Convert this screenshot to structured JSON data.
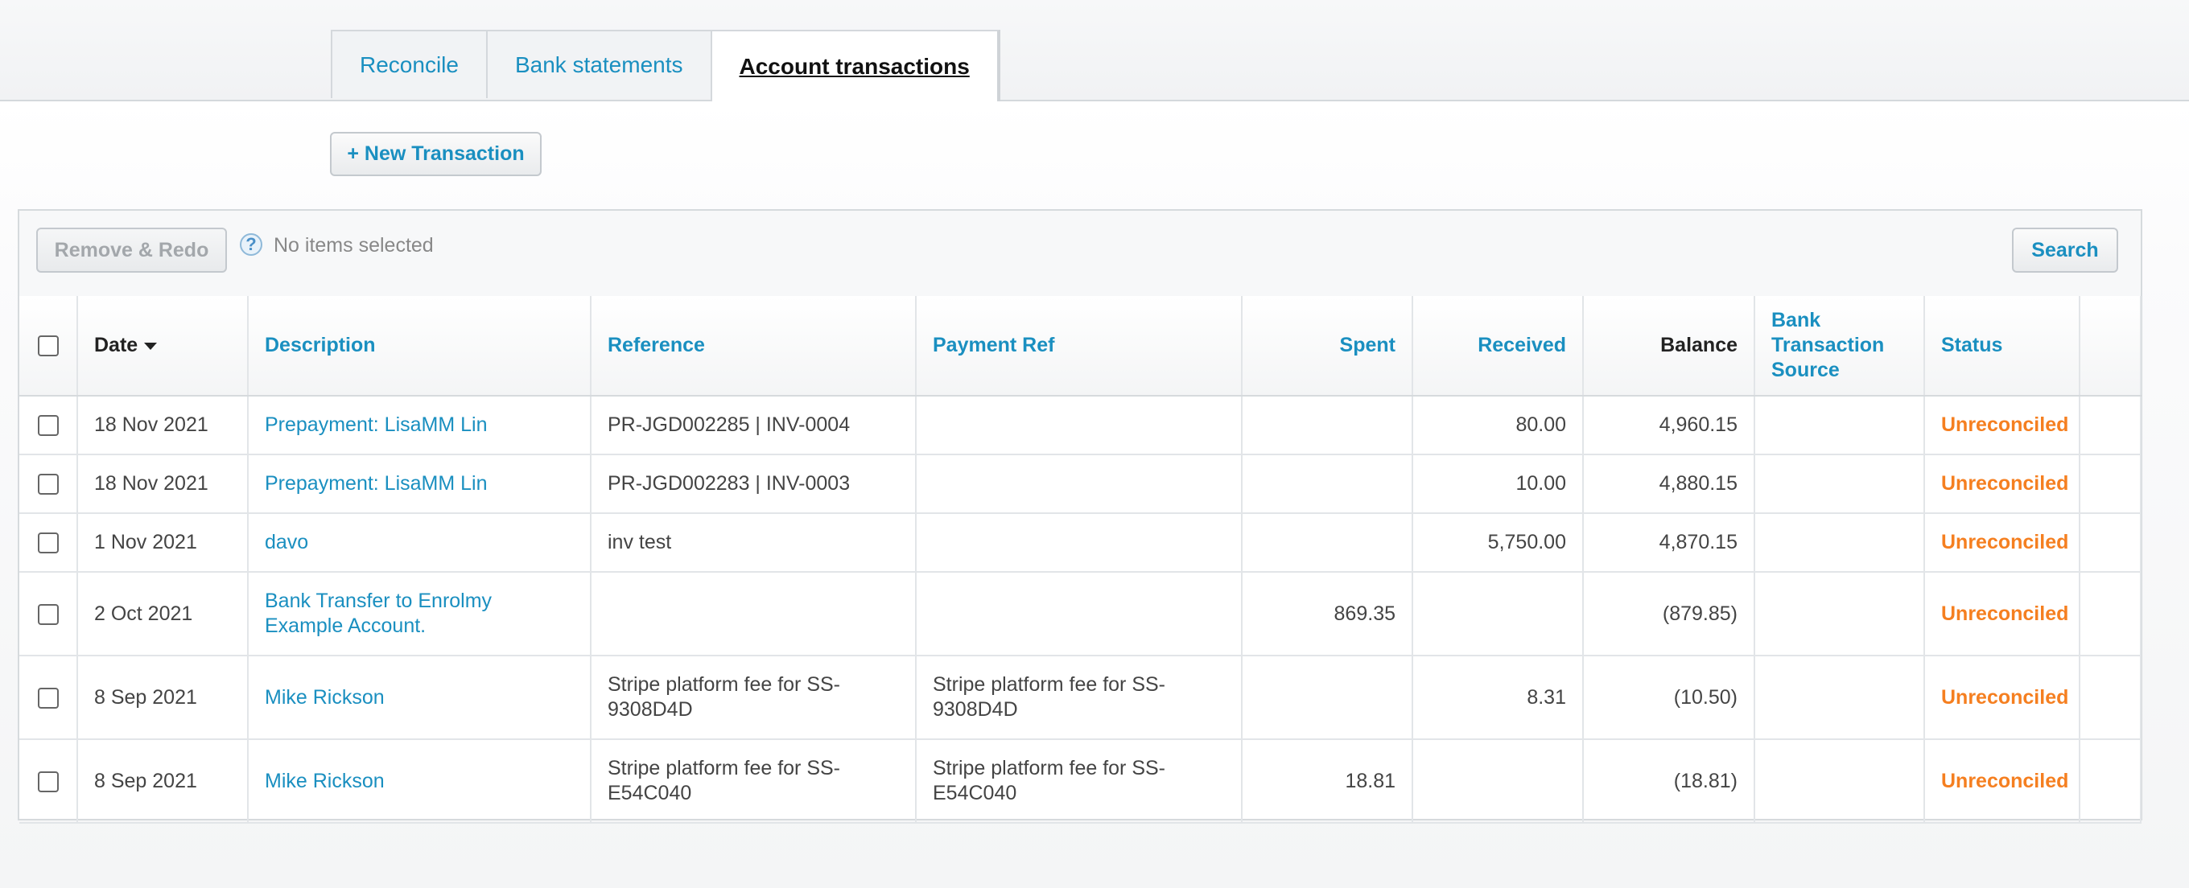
{
  "tabs": [
    {
      "label": "Reconcile",
      "active": false
    },
    {
      "label": "Bank statements",
      "active": false
    },
    {
      "label": "Account transactions",
      "active": true
    }
  ],
  "actions": {
    "new_transaction": "+ New Transaction"
  },
  "toolbar": {
    "remove_redo": "Remove & Redo",
    "help_icon": "?",
    "selection_text": "No items selected",
    "search": "Search"
  },
  "table": {
    "columns": {
      "date": "Date",
      "description": "Description",
      "reference": "Reference",
      "payment_ref": "Payment Ref",
      "spent": "Spent",
      "received": "Received",
      "balance": "Balance",
      "bank_source": "Bank Transaction Source",
      "status": "Status"
    },
    "rows": [
      {
        "date": "18 Nov 2021",
        "description": "Prepayment: LisaMM Lin",
        "reference": "PR-JGD002285 | INV-0004",
        "payment_ref": "",
        "spent": "",
        "received": "80.00",
        "balance": "4,960.15",
        "bank_source": "",
        "status": "Unreconciled"
      },
      {
        "date": "18 Nov 2021",
        "description": "Prepayment: LisaMM Lin",
        "reference": "PR-JGD002283 | INV-0003",
        "payment_ref": "",
        "spent": "",
        "received": "10.00",
        "balance": "4,880.15",
        "bank_source": "",
        "status": "Unreconciled"
      },
      {
        "date": "1 Nov 2021",
        "description": "davo",
        "reference": "inv test",
        "payment_ref": "",
        "spent": "",
        "received": "5,750.00",
        "balance": "4,870.15",
        "bank_source": "",
        "status": "Unreconciled"
      },
      {
        "date": "2 Oct 2021",
        "description": "Bank Transfer to Enrolmy Example Account.",
        "reference": "",
        "payment_ref": "",
        "spent": "869.35",
        "received": "",
        "balance": "(879.85)",
        "bank_source": "",
        "status": "Unreconciled"
      },
      {
        "date": "8 Sep 2021",
        "description": "Mike Rickson",
        "reference": "Stripe platform fee for SS-9308D4D",
        "payment_ref": "Stripe platform fee for SS-9308D4D",
        "spent": "",
        "received": "8.31",
        "balance": "(10.50)",
        "bank_source": "",
        "status": "Unreconciled"
      },
      {
        "date": "8 Sep 2021",
        "description": "Mike Rickson",
        "reference": "Stripe platform fee for SS-E54C040",
        "payment_ref": "Stripe platform fee for SS-E54C040",
        "spent": "18.81",
        "received": "",
        "balance": "(18.81)",
        "bank_source": "",
        "status": "Unreconciled"
      }
    ]
  }
}
